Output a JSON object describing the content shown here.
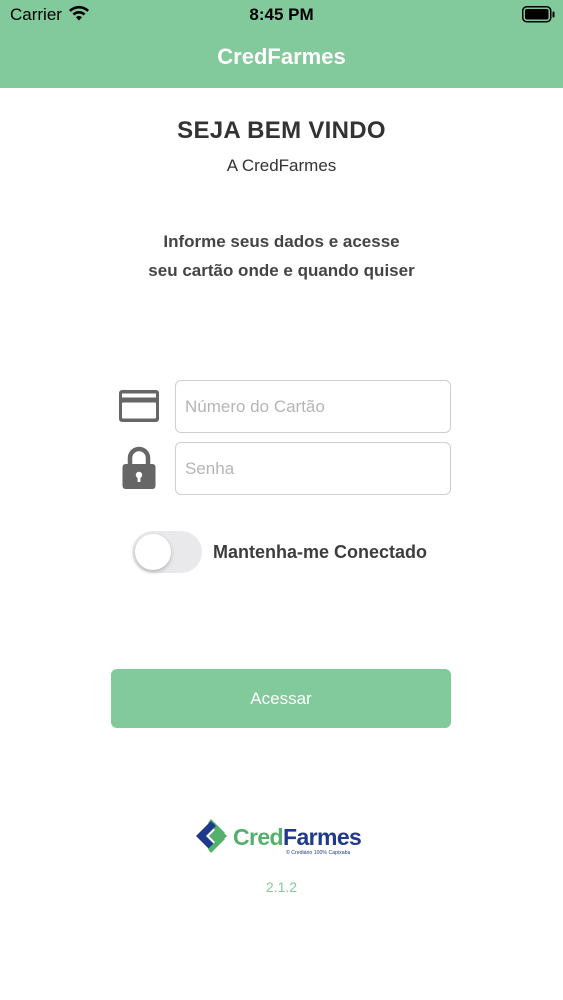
{
  "status_bar": {
    "carrier": "Carrier",
    "time": "8:45 PM",
    "wifi_icon": "wifi-icon",
    "battery_icon": "battery-icon"
  },
  "nav": {
    "title": "CredFarmes"
  },
  "welcome": {
    "title": "SEJA BEM VINDO",
    "subtitle": "A CredFarmes"
  },
  "instructions": {
    "line1": "Informe seus dados e acesse",
    "line2": "seu cartão onde e quando quiser"
  },
  "form": {
    "card_icon": "credit-card-icon",
    "card_placeholder": "Número do Cartão",
    "card_value": "",
    "lock_icon": "lock-icon",
    "password_placeholder": "Senha",
    "password_value": "",
    "remember_label": "Mantenha-me Conectado",
    "remember_on": false,
    "submit_label": "Acessar"
  },
  "footer": {
    "logo_text": "CredFarmes",
    "logo_tagline": "© Crediário 100% Capixaba",
    "version": "2.1.2"
  },
  "colors": {
    "brand_green": "#82c99b",
    "logo_blue": "#1f3a8a",
    "logo_green": "#54b06a",
    "icon_gray": "#666666"
  }
}
